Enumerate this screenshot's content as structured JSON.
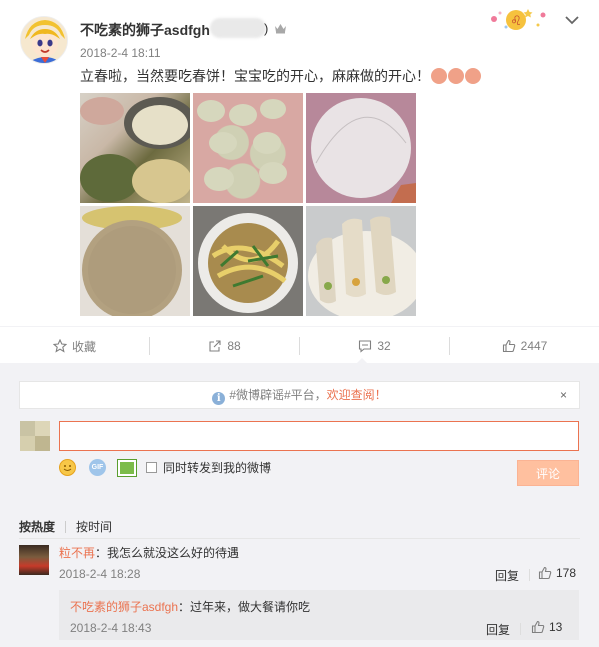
{
  "post": {
    "username": "不吃素的狮子asdfgh",
    "paren": ")",
    "time": "2018-2-4 18:11",
    "text": "立春啦，当然要吃春饼！宝宝吃的开心，麻麻做的开心！",
    "photos": [
      "photo-1",
      "photo-2",
      "photo-3",
      "photo-4",
      "photo-5",
      "photo-6"
    ]
  },
  "actions": {
    "favorite": "收藏",
    "repost": "88",
    "comment": "32",
    "like": "2447"
  },
  "notice": {
    "text": "#微博辟谣#平台，",
    "highlight": "欢迎查阅！",
    "close": "×"
  },
  "composer": {
    "input_value": "",
    "gif_label": "GIF",
    "forward_label": "同时转发到我的微博",
    "submit_label": "评论"
  },
  "sort": {
    "by_hot": "按热度",
    "by_time": "按时间"
  },
  "comments": [
    {
      "author": "粒不再",
      "text": "：我怎么就没这么好的待遇",
      "time": "2018-2-4 18:28",
      "reply": "回复",
      "likes": "178"
    }
  ],
  "replies": [
    {
      "author": "不吃素的狮子asdfgh",
      "text": "：过年来，做大餐请你吃",
      "time": "2018-2-4 18:43",
      "reply": "回复",
      "likes": "13"
    }
  ],
  "colors": {
    "accent": "#eb7350",
    "panel_bg": "#f2f2f5",
    "submit_bg": "#ffc09f"
  }
}
